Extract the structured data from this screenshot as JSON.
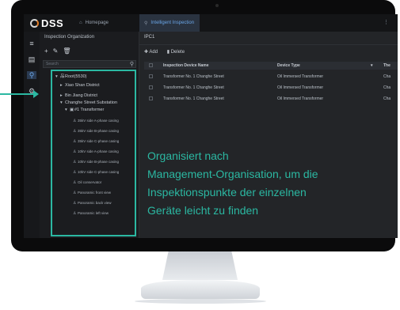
{
  "app": {
    "logo": "DSS",
    "tabs": [
      {
        "label": "Homepage"
      },
      {
        "label": "Intelligent Inspection"
      }
    ]
  },
  "left_panel": {
    "title": "Inspection Organization",
    "tools": [
      "+",
      "✎",
      "🗑"
    ],
    "search_placeholder": "Search",
    "tree": [
      {
        "label": "Root(5530)"
      },
      {
        "label": "Xiao Shan District"
      },
      {
        "label": "Bin Jiang District"
      },
      {
        "label": "Changhe Street Substation"
      },
      {
        "label": "#1 Transformer"
      },
      {
        "label": "35kV side A-phase casing"
      },
      {
        "label": "35kV side B-phase casing"
      },
      {
        "label": "35kV side C-phase casing"
      },
      {
        "label": "10kV side A-phase casing"
      },
      {
        "label": "10kV side B-phase casing"
      },
      {
        "label": "10kV side C-phase casing"
      },
      {
        "label": "Oil conservator"
      },
      {
        "label": "Panoramic front view"
      },
      {
        "label": "Panoramic back view"
      },
      {
        "label": "Panoramic left view"
      }
    ]
  },
  "main": {
    "title": "IPC1",
    "toolbar": {
      "add": "Add",
      "delete": "Delete"
    },
    "table": {
      "headers": [
        "Inspection Device Name",
        "Device Type",
        "The"
      ],
      "rows": [
        [
          "Transformer No. 1 Changhe Street",
          "Oil Immersed Transformer",
          "Cha"
        ],
        [
          "Transformer No. 1 Changhe Street",
          "Oil Immersed Transformer",
          "Cha"
        ],
        [
          "Transformer No. 1 Changhe Street",
          "Oil Immersed Transformer",
          "Cha"
        ]
      ]
    }
  },
  "annotation": {
    "lines": [
      "Organisiert nach",
      "Management-Organisation, um die",
      "Inspektionspunkte der einzelnen",
      "Geräte leicht zu finden"
    ],
    "color": "#2bb8a2"
  }
}
